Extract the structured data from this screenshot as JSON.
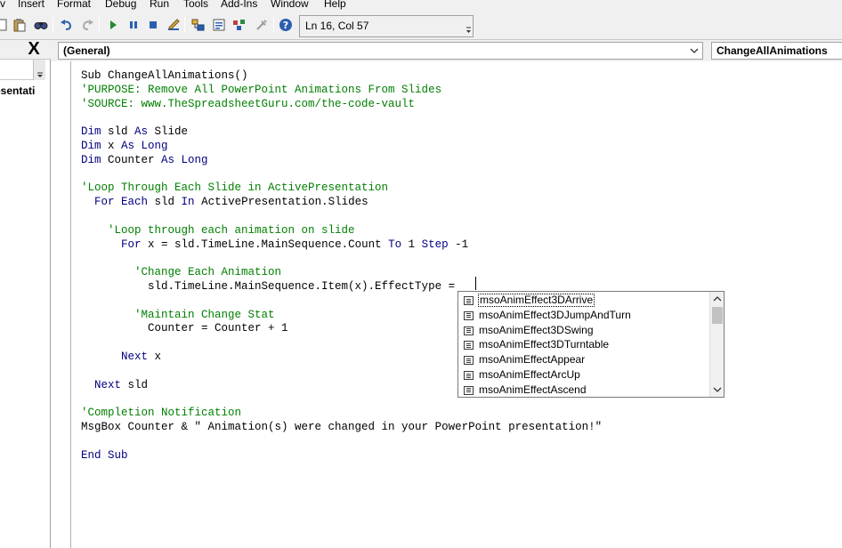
{
  "menu": [
    {
      "label": "v"
    },
    {
      "label": "Insert"
    },
    {
      "label": "Format"
    },
    {
      "label": "Debug"
    },
    {
      "label": "Run"
    },
    {
      "label": "Tools"
    },
    {
      "label": "Add-Ins"
    },
    {
      "label": "Window"
    },
    {
      "label": "Help"
    }
  ],
  "toolbar": {
    "position": "Ln 16, Col 57",
    "icons": [
      "page-icon",
      "paste-icon",
      "find-icon",
      "undo-icon",
      "redo-icon",
      "run-icon",
      "break-icon",
      "reset-icon",
      "design-mode-icon",
      "project-explorer-icon",
      "properties-icon",
      "object-browser-icon",
      "toolbox-icon",
      "help-icon"
    ]
  },
  "project_panel": {
    "close_label": "X",
    "item_label": "esentati"
  },
  "code_window": {
    "object_combo": "(General)",
    "procedure_combo": "ChangeAllAnimations",
    "lines": [
      {
        "segments": [
          {
            "t": "Sub ChangeAllAnimations()",
            "c": "plain"
          }
        ]
      },
      {
        "segments": [
          {
            "t": "'PURPOSE: Remove All PowerPoint Animations From Slides",
            "c": "comment"
          }
        ]
      },
      {
        "segments": [
          {
            "t": "'SOURCE: www.TheSpreadsheetGuru.com/the-code-vault",
            "c": "comment"
          }
        ]
      },
      {
        "segments": [
          {
            "t": "",
            "c": "plain"
          }
        ]
      },
      {
        "segments": [
          {
            "t": "Dim",
            "c": "keyword"
          },
          {
            "t": " sld ",
            "c": "plain"
          },
          {
            "t": "As",
            "c": "keyword"
          },
          {
            "t": " Slide",
            "c": "plain"
          }
        ]
      },
      {
        "segments": [
          {
            "t": "Dim",
            "c": "keyword"
          },
          {
            "t": " x ",
            "c": "plain"
          },
          {
            "t": "As Long",
            "c": "keyword"
          }
        ]
      },
      {
        "segments": [
          {
            "t": "Dim",
            "c": "keyword"
          },
          {
            "t": " Counter ",
            "c": "plain"
          },
          {
            "t": "As Long",
            "c": "keyword"
          }
        ]
      },
      {
        "segments": [
          {
            "t": "",
            "c": "plain"
          }
        ]
      },
      {
        "segments": [
          {
            "t": "'Loop Through Each Slide in ActivePresentation",
            "c": "comment"
          }
        ]
      },
      {
        "segments": [
          {
            "t": "  ",
            "c": "plain"
          },
          {
            "t": "For Each",
            "c": "keyword"
          },
          {
            "t": " sld ",
            "c": "plain"
          },
          {
            "t": "In",
            "c": "keyword"
          },
          {
            "t": " ActivePresentation.Slides",
            "c": "plain"
          }
        ]
      },
      {
        "segments": [
          {
            "t": "",
            "c": "plain"
          }
        ]
      },
      {
        "segments": [
          {
            "t": "    'Loop through each animation on slide",
            "c": "comment"
          }
        ]
      },
      {
        "segments": [
          {
            "t": "      ",
            "c": "plain"
          },
          {
            "t": "For",
            "c": "keyword"
          },
          {
            "t": " x = sld.TimeLine.MainSequence.Count ",
            "c": "plain"
          },
          {
            "t": "To",
            "c": "keyword"
          },
          {
            "t": " 1 ",
            "c": "plain"
          },
          {
            "t": "Step",
            "c": "keyword"
          },
          {
            "t": " -1",
            "c": "plain"
          }
        ]
      },
      {
        "segments": [
          {
            "t": "",
            "c": "plain"
          }
        ]
      },
      {
        "segments": [
          {
            "t": "        'Change Each Animation",
            "c": "comment"
          }
        ]
      },
      {
        "segments": [
          {
            "t": "          sld.TimeLine.MainSequence.Item(x).EffectType =",
            "c": "plain"
          }
        ]
      },
      {
        "segments": [
          {
            "t": "",
            "c": "plain"
          }
        ]
      },
      {
        "segments": [
          {
            "t": "        'Maintain Change Stat",
            "c": "comment"
          }
        ]
      },
      {
        "segments": [
          {
            "t": "          Counter = Counter + 1",
            "c": "plain"
          }
        ]
      },
      {
        "segments": [
          {
            "t": "",
            "c": "plain"
          }
        ]
      },
      {
        "segments": [
          {
            "t": "      ",
            "c": "plain"
          },
          {
            "t": "Next",
            "c": "keyword"
          },
          {
            "t": " x",
            "c": "plain"
          }
        ]
      },
      {
        "segments": [
          {
            "t": "",
            "c": "plain"
          }
        ]
      },
      {
        "segments": [
          {
            "t": "  ",
            "c": "plain"
          },
          {
            "t": "Next",
            "c": "keyword"
          },
          {
            "t": " sld",
            "c": "plain"
          }
        ]
      },
      {
        "segments": [
          {
            "t": "",
            "c": "plain"
          }
        ]
      },
      {
        "segments": [
          {
            "t": "'Completion Notification",
            "c": "comment"
          }
        ]
      },
      {
        "segments": [
          {
            "t": "MsgBox Counter & \" Animation(s) were changed in your PowerPoint presentation!\"",
            "c": "plain"
          }
        ]
      },
      {
        "segments": [
          {
            "t": "",
            "c": "plain"
          }
        ]
      },
      {
        "segments": [
          {
            "t": "End Sub",
            "c": "keyword"
          }
        ]
      }
    ]
  },
  "autocomplete": {
    "items": [
      "msoAnimEffect3DArrive",
      "msoAnimEffect3DJumpAndTurn",
      "msoAnimEffect3DSwing",
      "msoAnimEffect3DTurntable",
      "msoAnimEffectAppear",
      "msoAnimEffectArcUp",
      "msoAnimEffectAscend"
    ],
    "selected_index": 0
  },
  "colors": {
    "keyword": "#00007f",
    "comment": "#007f00",
    "plain": "#000000"
  }
}
